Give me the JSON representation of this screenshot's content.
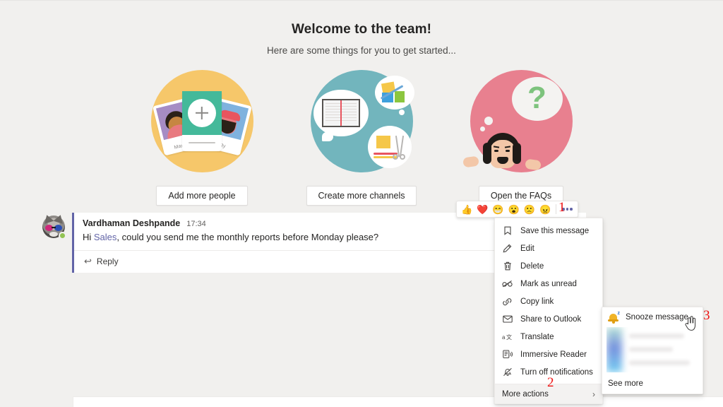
{
  "welcome": {
    "title": "Welcome to the team!",
    "subtitle": "Here are some things for you to get started..."
  },
  "cards": [
    {
      "id": "add-people",
      "circle_color": "#f6c76a",
      "button_label": "Add more people",
      "name_left": "Maxine",
      "name_right": "Ry"
    },
    {
      "id": "create-channels",
      "circle_color": "#72b5bd",
      "button_label": "Create more channels"
    },
    {
      "id": "open-faqs",
      "circle_color": "#e8808f",
      "question_mark": "?",
      "button_label": "Open the FAQs"
    }
  ],
  "message": {
    "author": "Vardhaman Deshpande",
    "time": "17:34",
    "text_before": "Hi ",
    "mention": "Sales",
    "text_after": ", could you send me the monthly reports before Monday please?",
    "reply_label": "Reply",
    "reply_icon": "↩",
    "accent_color": "#6264a7",
    "presence": "available"
  },
  "reaction_bar": {
    "reactions": [
      {
        "name": "thumbs-up",
        "glyph": "👍"
      },
      {
        "name": "heart",
        "glyph": "❤️"
      },
      {
        "name": "laugh",
        "glyph": "😁"
      },
      {
        "name": "surprised",
        "glyph": "😮"
      },
      {
        "name": "sad",
        "glyph": "🙁"
      },
      {
        "name": "angry",
        "glyph": "😠"
      }
    ],
    "more_label": "More options"
  },
  "context_menu": {
    "items": [
      {
        "icon": "bookmark-icon",
        "label": "Save this message"
      },
      {
        "icon": "pencil-icon",
        "label": "Edit"
      },
      {
        "icon": "trash-icon",
        "label": "Delete"
      },
      {
        "icon": "glasses-icon",
        "label": "Mark as unread"
      },
      {
        "icon": "link-icon",
        "label": "Copy link"
      },
      {
        "icon": "envelope-icon",
        "label": "Share to Outlook"
      },
      {
        "icon": "translate-icon",
        "label": "Translate"
      },
      {
        "icon": "immersive-reader-icon",
        "label": "Immersive Reader"
      },
      {
        "icon": "bell-off-icon",
        "label": "Turn off notifications"
      }
    ],
    "more_actions_label": "More actions",
    "chevron": "›"
  },
  "submenu": {
    "snooze_label": "Snooze message",
    "see_more_label": "See more"
  },
  "annotations": {
    "one": "1",
    "two": "2",
    "three": "3",
    "color": "#ee1111"
  }
}
